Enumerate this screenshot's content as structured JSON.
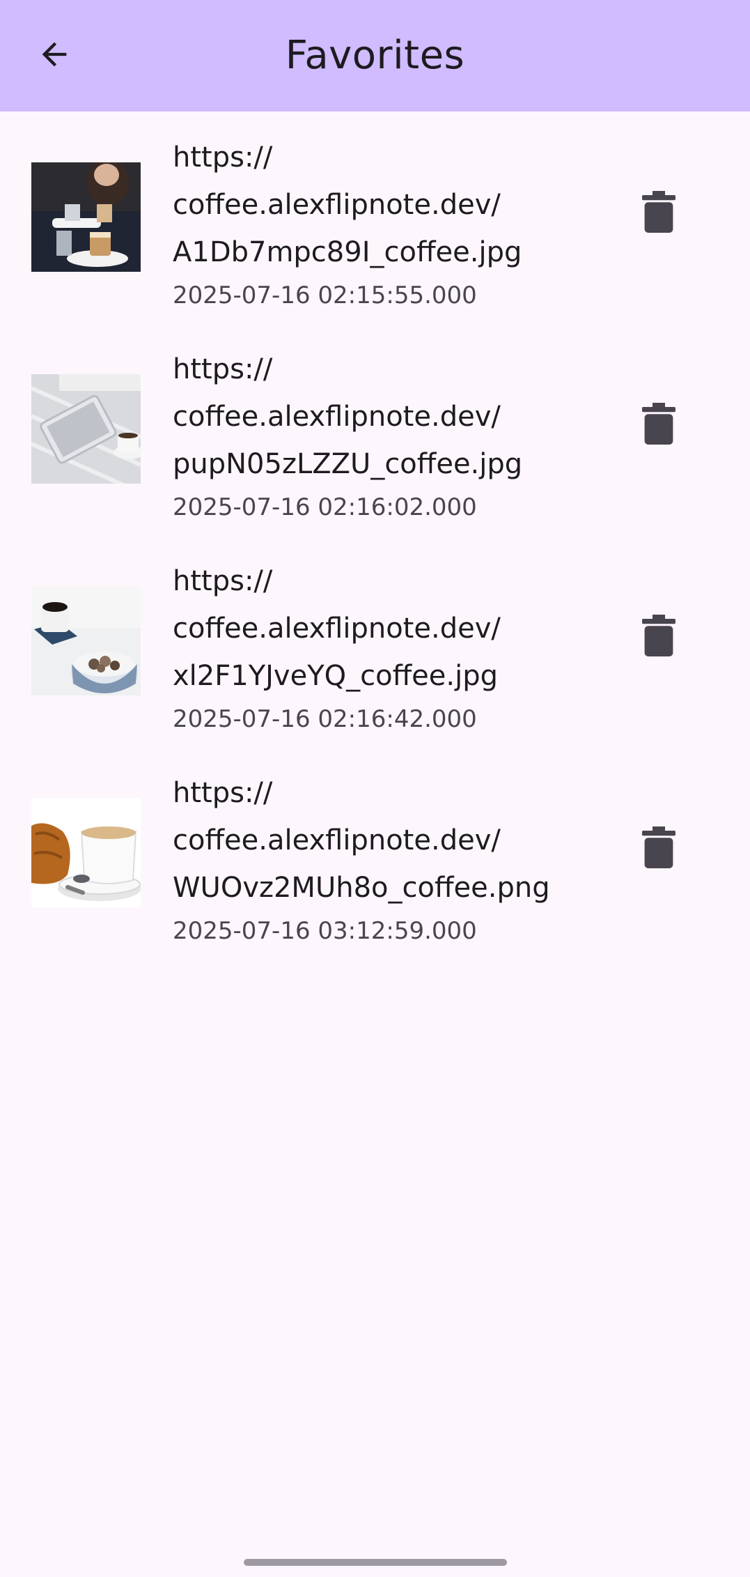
{
  "app_bar": {
    "title": "Favorites",
    "back_icon": "arrow-back-icon",
    "background": "#d0bcfe"
  },
  "favorites": [
    {
      "url_lines": [
        "https://",
        "coffee.alexflipnote.dev/",
        "A1Db7mpc89I_coffee.jpg"
      ],
      "timestamp": "2025-07-16 02:15:55.000",
      "delete_icon": "trash-icon"
    },
    {
      "url_lines": [
        "https://",
        "coffee.alexflipnote.dev/",
        "pupN05zLZZU_coffee.jpg"
      ],
      "timestamp": "2025-07-16 02:16:02.000",
      "delete_icon": "trash-icon"
    },
    {
      "url_lines": [
        "https://",
        "coffee.alexflipnote.dev/",
        "xl2F1YJveYQ_coffee.jpg"
      ],
      "timestamp": "2025-07-16 02:16:42.000",
      "delete_icon": "trash-icon"
    },
    {
      "url_lines": [
        "https://",
        "coffee.alexflipnote.dev/",
        "WUOvz2MUh8o_coffee.png"
      ],
      "timestamp": "2025-07-16 03:12:59.000",
      "delete_icon": "trash-icon"
    }
  ],
  "colors": {
    "background": "#fdf7fd",
    "primary_text": "#1d1b20",
    "secondary_text": "#49454f",
    "icon": "#49454f"
  }
}
